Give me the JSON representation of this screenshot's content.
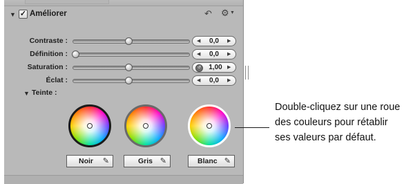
{
  "section": {
    "title": "Améliorer",
    "checked": "✓",
    "disclosure": "▼",
    "undo_icon": "undo-arrow-icon",
    "gear_icon": "gear-menu-icon"
  },
  "rows": [
    {
      "label": "Contraste :",
      "value": "0,0",
      "level": 0.5
    },
    {
      "label": "Définition :",
      "value": "0,0",
      "level": 0.0
    },
    {
      "label": "Saturation :",
      "value": "1,00",
      "level": 0.5
    },
    {
      "label": "Éclat :",
      "value": "0,0",
      "level": 0.5
    }
  ],
  "tint": {
    "label": "Teinte :",
    "disclosure": "▼",
    "wells": [
      {
        "label": "Noir"
      },
      {
        "label": "Gris"
      },
      {
        "label": "Blanc"
      }
    ]
  },
  "callout": {
    "text": "Double-cliquez sur une roue des couleurs pour rétablir ses valeurs par défaut."
  },
  "glyphs": {
    "left_arrow": "◀",
    "right_arrow": "▶",
    "undo": "↶",
    "gear": "⚙",
    "eyedropper": "✎"
  }
}
